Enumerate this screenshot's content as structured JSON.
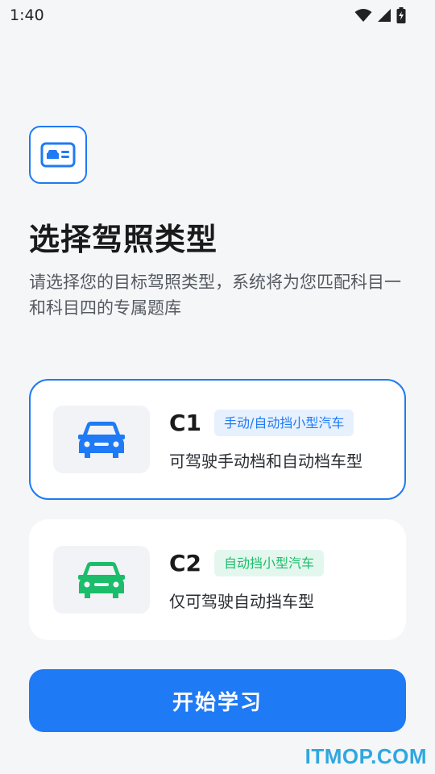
{
  "status_bar": {
    "time": "1:40",
    "icons": [
      "wifi-icon",
      "cell-signal-icon",
      "battery-charging-icon"
    ]
  },
  "header": {
    "icon": "driver-license-icon",
    "title": "选择驾照类型",
    "subtitle": "请选择您的目标驾照类型，系统将为您匹配科目一和科目四的专属题库"
  },
  "options": [
    {
      "code": "C1",
      "badge": "手动/自动挡小型汽车",
      "description": "可驾驶手动档和自动档车型",
      "icon": "car-icon",
      "color": "#1f7af5",
      "selected": true
    },
    {
      "code": "C2",
      "badge": "自动挡小型汽车",
      "description": "仅可驾驶自动挡车型",
      "icon": "car-icon",
      "color": "#1bbd6a",
      "selected": false
    }
  ],
  "start_button": {
    "label": "开始学习"
  },
  "colors": {
    "accent": "#1f7af5",
    "green": "#1bbd6a",
    "background": "#f5f6f8"
  },
  "watermark": "ITMOP.COM"
}
